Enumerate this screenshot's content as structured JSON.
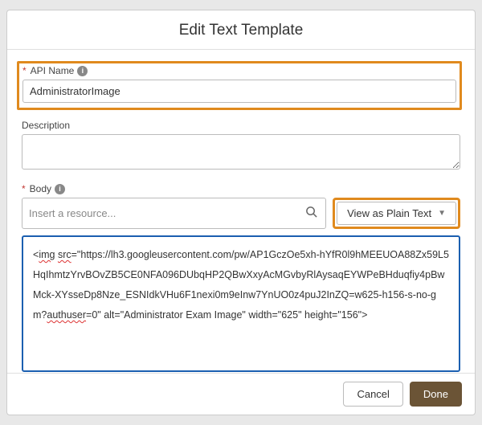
{
  "modal": {
    "title": "Edit Text Template",
    "apiName": {
      "label": "API Name",
      "required": "*",
      "value": "AdministratorImage"
    },
    "description": {
      "label": "Description",
      "value": ""
    },
    "body": {
      "label": "Body",
      "required": "*",
      "resourcePlaceholder": "Insert a resource...",
      "viewButton": "View as Plain Text",
      "content": "<img src=\"https://lh3.googleusercontent.com/pw/AP1GczOe5xh-hYfR0l9hMEEUOA88Zx59L5HqIhmtzYrvBOvZB5CE0NFA096DUbqHP2QBwXxyAcMGvbyRlAysaqEYWPeBHduqfiy4pBwMck-XYsseDp8Nze_ESNIdkVHu6F1nexi0m9eInw7YnUO0z4puJ2InZQ=w625-h156-s-no-gm?authuser=0\" alt=\"Administrator Exam Image\" width=\"625\" height=\"156\">",
      "seg1": "<",
      "seg2": "img",
      "seg3": " ",
      "seg4": "src",
      "seg5": "=\"https://lh3.googleusercontent.com/pw/AP1GczOe5xh-hYfR0l9hMEEUOA88Zx59L5HqIhmtzYrvBOvZB5CE0NFA096DUbqHP2QBwXxyAcMGvbyRlAysaqEYWPeBHduqfiy4pBwMck-XYsseDp8Nze_ESNIdkVHu6F1nexi0m9eInw7YnUO0z4puJ2InZQ=w625-h156-s-no-gm?",
      "seg6": "authuser",
      "seg7": "=0\" alt=\"Administrator Exam Image\" width=\"625\" height=\"156\">"
    },
    "footer": {
      "cancel": "Cancel",
      "done": "Done"
    }
  }
}
